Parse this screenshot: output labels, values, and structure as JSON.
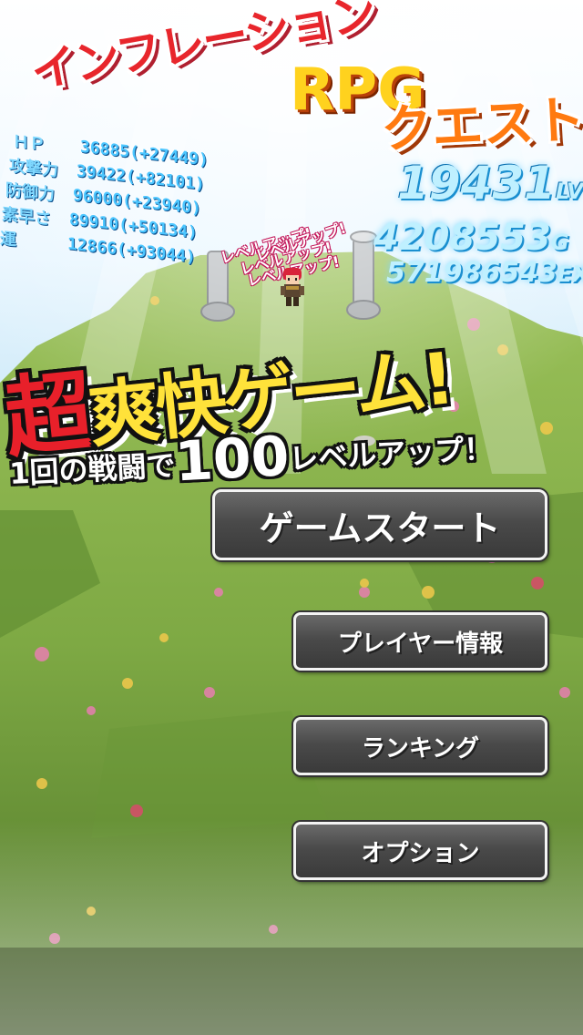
{
  "title": {
    "line1": "インフレーション",
    "rpg": "RPG",
    "line3": "クエスト"
  },
  "stats": [
    {
      "label": "ＨＰ",
      "value": "36885(+27449)"
    },
    {
      "label": "攻撃力",
      "value": "39422(+82101)"
    },
    {
      "label": "防御力",
      "value": "96000(+23940)"
    },
    {
      "label": "素早さ",
      "value": "89910(+50134)"
    },
    {
      "label": "運",
      "value": "12866(+93044)"
    }
  ],
  "progress": {
    "level": "19431",
    "level_unit": "LV",
    "gold": "4208553",
    "gold_unit": "G",
    "exp": "571986543",
    "exp_unit": "EXP"
  },
  "level_up_popups": [
    "レベルアップ!",
    "レベルアップ!",
    "レベルアップ!",
    "レベルアップ!"
  ],
  "banner": {
    "main_prefix": "超",
    "main_rest": "爽快ゲーム!",
    "sub_prefix": "1回の戦闘で",
    "sub_number": "100",
    "sub_suffix": "レベルアップ！"
  },
  "menu": {
    "start": "ゲームスタート",
    "player_info": "プレイヤー情報",
    "ranking": "ランキング",
    "options": "オプション"
  }
}
